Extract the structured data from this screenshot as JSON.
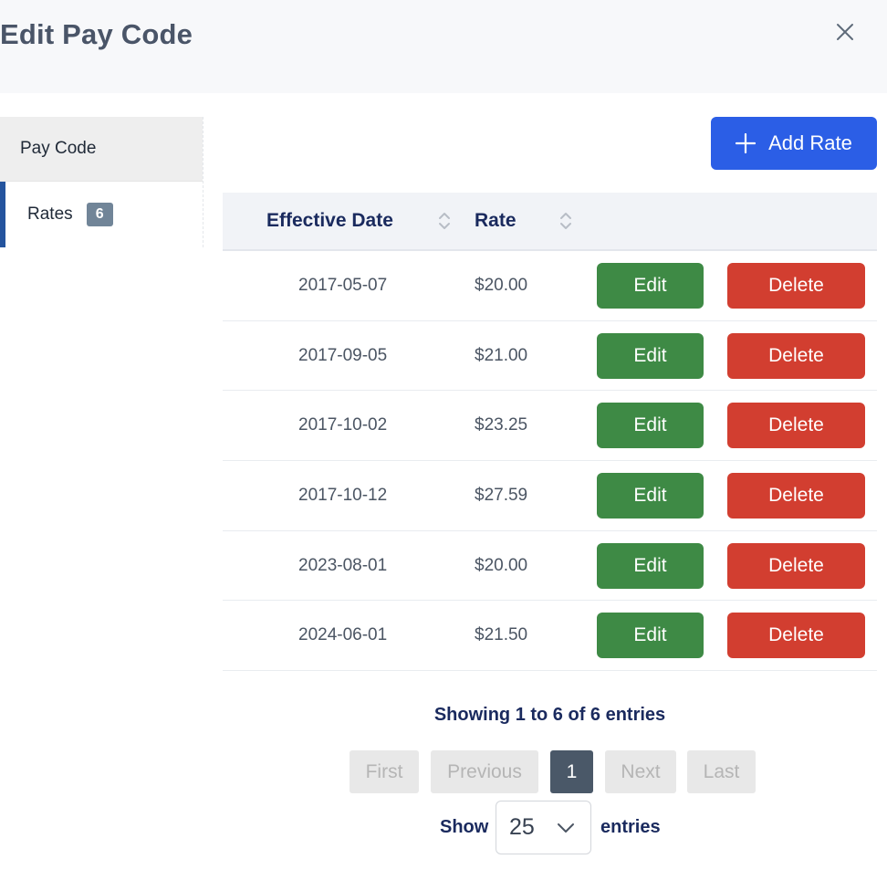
{
  "modal": {
    "title": "Edit Pay Code"
  },
  "sidebar": {
    "items": [
      {
        "label": "Pay Code"
      },
      {
        "label": "Rates",
        "badge": "6"
      }
    ]
  },
  "toolbar": {
    "add_label": "Add Rate"
  },
  "table": {
    "headers": {
      "effective_date": "Effective Date",
      "rate": "Rate"
    },
    "rows": [
      {
        "date": "2017-05-07",
        "rate": "$20.00",
        "edit": "Edit",
        "delete": "Delete"
      },
      {
        "date": "2017-09-05",
        "rate": "$21.00",
        "edit": "Edit",
        "delete": "Delete"
      },
      {
        "date": "2017-10-02",
        "rate": "$23.25",
        "edit": "Edit",
        "delete": "Delete"
      },
      {
        "date": "2017-10-12",
        "rate": "$27.59",
        "edit": "Edit",
        "delete": "Delete"
      },
      {
        "date": "2023-08-01",
        "rate": "$20.00",
        "edit": "Edit",
        "delete": "Delete"
      },
      {
        "date": "2024-06-01",
        "rate": "$21.50",
        "edit": "Edit",
        "delete": "Delete"
      }
    ]
  },
  "footer": {
    "info": "Showing 1 to 6 of 6 entries",
    "pagination": {
      "first": "First",
      "previous": "Previous",
      "current": "1",
      "next": "Next",
      "last": "Last"
    },
    "show_label": "Show",
    "page_size": "25",
    "entries_label": "entries"
  },
  "colors": {
    "primary": "#2b5ee6",
    "edit": "#3e8a45",
    "delete": "#d23e30",
    "sidebar_active": "#24549e",
    "page_active": "#4a5868"
  },
  "icons": {
    "close": "close-icon",
    "add": "plus-icon",
    "sort": "sort-icon",
    "select": "chevron-down-icon"
  }
}
